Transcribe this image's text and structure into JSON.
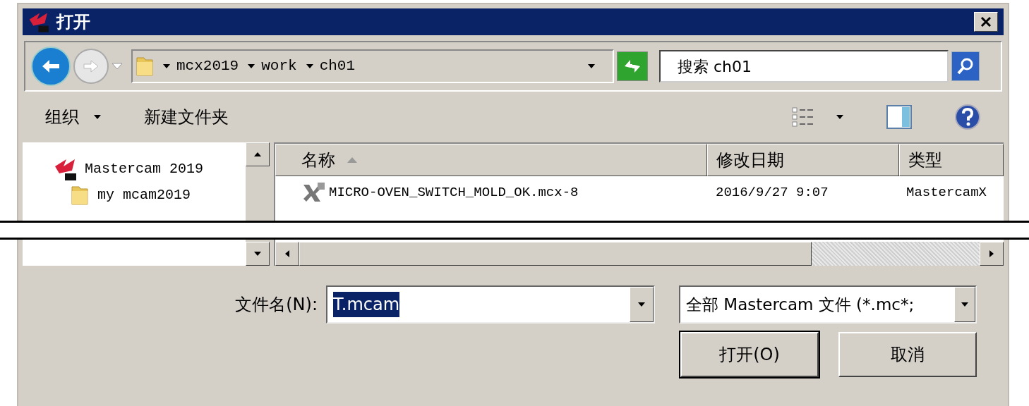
{
  "window": {
    "title": "打开"
  },
  "address": {
    "segments": [
      "mcx2019",
      "work",
      "ch01"
    ]
  },
  "search": {
    "placeholder": "搜索 ch01"
  },
  "toolbar": {
    "items": [
      {
        "label": "组织",
        "dropdown": true
      },
      {
        "label": "新建文件夹",
        "dropdown": false
      }
    ]
  },
  "nav_tree": [
    {
      "label": "Mastercam 2019",
      "kind": "app",
      "children": [
        {
          "label": "my mcam2019",
          "kind": "folder"
        }
      ]
    }
  ],
  "table": {
    "columns": [
      {
        "label": "名称",
        "sorted": true
      },
      {
        "label": "修改日期",
        "sorted": false
      },
      {
        "label": "类型",
        "sorted": false
      }
    ],
    "rows": [
      {
        "cells": [
          "MICRO-OVEN_SWITCH_MOLD_OK.mcx-8",
          "2016/9/27 9:07",
          "MastercamX"
        ]
      }
    ]
  },
  "file_name": {
    "label": "文件名(N):",
    "value": "T.mcam",
    "selected": true
  },
  "file_type": {
    "value": "全部 Mastercam 文件 (*.mc*;"
  },
  "buttons": [
    {
      "label": "打开(O)",
      "default": true
    },
    {
      "label": "取消",
      "default": false
    }
  ]
}
